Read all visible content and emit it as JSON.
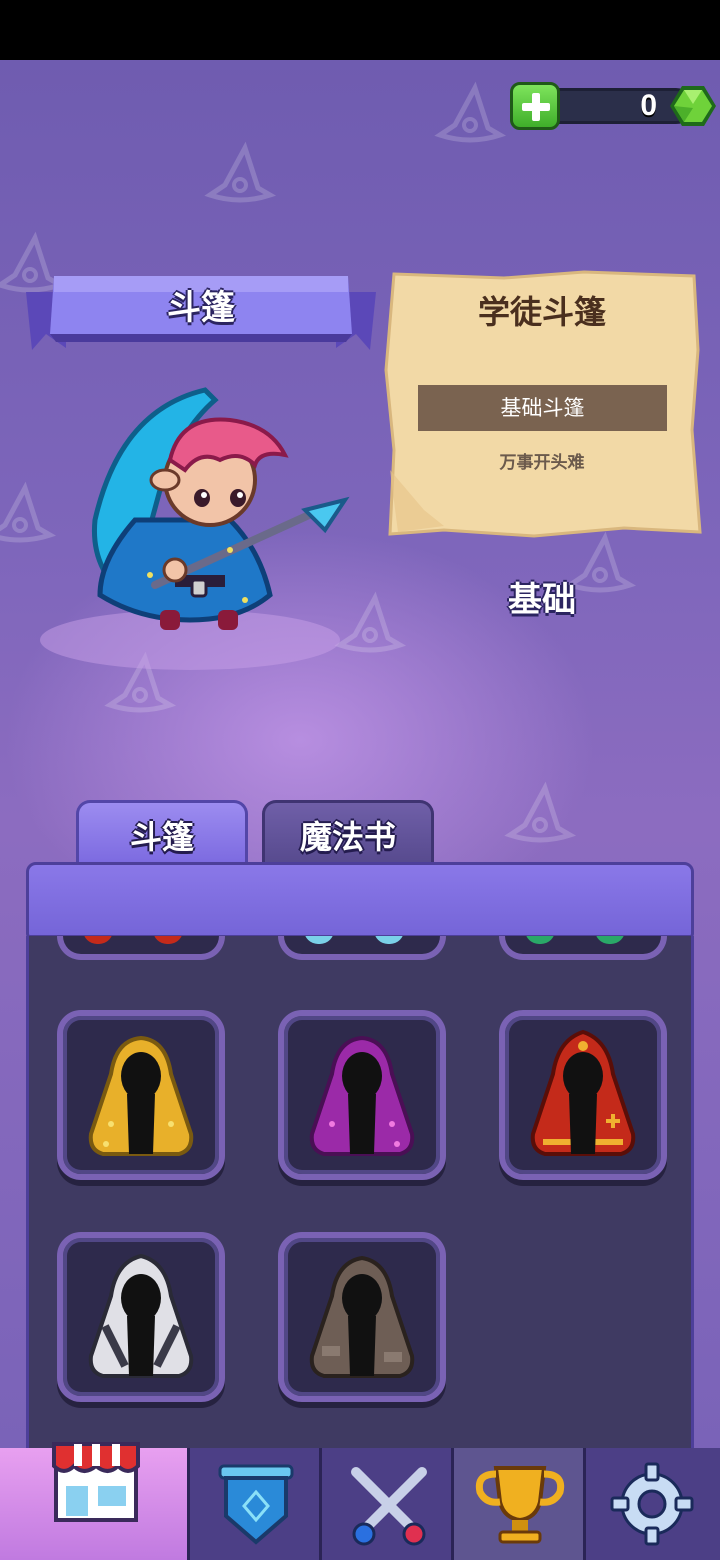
{
  "currency": {
    "amount": "0",
    "add_icon": "plus-icon",
    "gem_icon": "green-gem-icon"
  },
  "ribbon": {
    "title": "斗篷"
  },
  "detail": {
    "name": "学徒斗篷",
    "tag": "基础斗篷",
    "description": "万事开头难",
    "tier": "基础"
  },
  "tabs": [
    {
      "label": "斗篷",
      "active": true
    },
    {
      "label": "魔法书",
      "active": false
    }
  ],
  "cloaks": [
    {
      "name": "yellow-star-cloak",
      "color": "#e8b02a"
    },
    {
      "name": "purple-star-cloak",
      "color": "#9b2aa8"
    },
    {
      "name": "red-gold-cloak",
      "color": "#c42a1a"
    },
    {
      "name": "white-grey-cloak",
      "color": "#e0e0e6"
    },
    {
      "name": "brown-patch-cloak",
      "color": "#6e5e55"
    }
  ],
  "nav": [
    {
      "icon": "shop-icon",
      "active": true
    },
    {
      "icon": "shield-icon",
      "active": false
    },
    {
      "icon": "crossed-swords-icon",
      "active": false
    },
    {
      "icon": "trophy-icon",
      "active": false
    },
    {
      "icon": "gear-icon",
      "active": false
    }
  ]
}
